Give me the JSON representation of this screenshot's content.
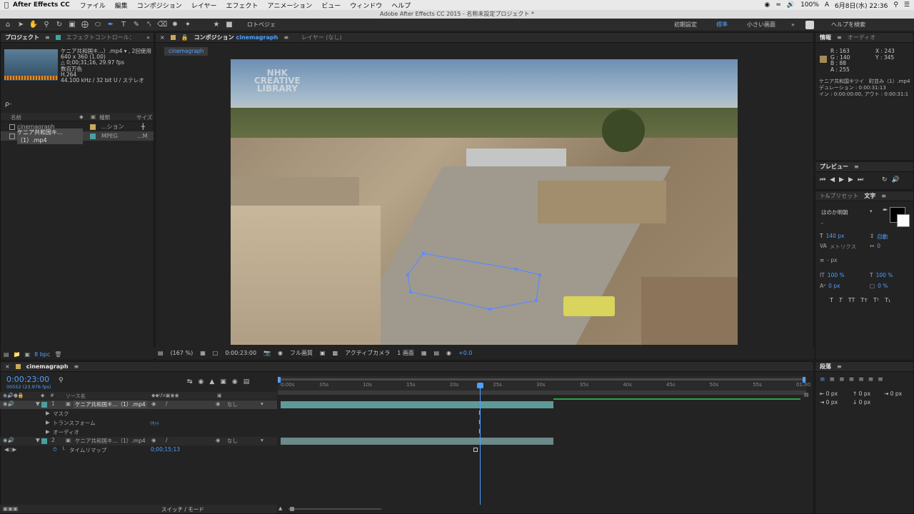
{
  "menubar": {
    "apple": "",
    "app_name": "After Effects CC",
    "items": [
      "ファイル",
      "編集",
      "コンポジション",
      "レイヤー",
      "エフェクト",
      "アニメーション",
      "ビュー",
      "ウィンドウ",
      "ヘルプ"
    ],
    "battery": "100%",
    "clock": "6月8日(水) 22:36"
  },
  "window_title": "Adobe After Effects CC 2015 - 名称未設定プロジェクト *",
  "toolbar": {
    "rotobrush": "ロトベジェ",
    "workspace_default": "初期設定",
    "workspace_standard": "標準",
    "workspace_small": "小さい画面",
    "help_search": "ヘルプを検索"
  },
  "project_panel": {
    "tab_project": "プロジェクト",
    "tab_effects": "エフェクトコントロール：",
    "asset_name": "ケニア共和国キ...）.mp4 ▾ , 2回使用",
    "asset_info": [
      "640 x 360 (1.00)",
      "△ 0;00;31;16, 29.97 fps",
      "数百万色",
      "H.264",
      "44.100 kHz / 32 bit U / ステレオ"
    ],
    "search_placeholder": "ρ-",
    "col_name": "名前",
    "col_type": "種類",
    "col_size": "サイズ",
    "items": [
      {
        "name": "cinemagraph",
        "type": "...ション",
        "size": ""
      },
      {
        "name": "ケニア共和国キ...（1）.mp4",
        "type": "MPEG",
        "size": "...M"
      }
    ],
    "bpc": "8 bpc"
  },
  "comp_panel": {
    "tab_label": "コンポジション",
    "tab_comp_name": "cinemagraph",
    "tab_layer": "レイヤー (なし)",
    "sub_tab": "cinemagraph",
    "watermark_line1": "NHK",
    "watermark_line2": "CREATIVE",
    "watermark_line3": "LIBRARY",
    "footer": {
      "zoom": "(167 %)",
      "timecode": "0:00:23:00",
      "resolution": "フル画質",
      "camera": "アクティブカメラ",
      "views": "1 画面",
      "exposure": "+0.0"
    }
  },
  "info_panel": {
    "tab_info": "情報",
    "tab_audio": "オーディオ",
    "r": "R : 163",
    "g": "G : 140",
    "b": "B : 88",
    "a": "A : 255",
    "x": "X : 243",
    "y": "Y : 345",
    "swatch_color": "#a38c58",
    "file_line": "ケニア共和国キツイ　町並み（1）.mp4",
    "duration_line": "デュレーション : 0:00:31:13",
    "inout_line": "イン : 0:00:00:00, アウト : 0:00:31:1"
  },
  "preview_panel": {
    "title": "プレビュー"
  },
  "character_panel": {
    "tab_presets": "ト&プリセット",
    "tab_character": "文字",
    "font_family": "ほのか明朝",
    "font_style": "-",
    "font_size": "140 px",
    "leading": "自動",
    "kerning": "メトリクス",
    "tracking": "0",
    "stroke": "- px",
    "vscale": "100 %",
    "hscale": "100 %",
    "baseline": "0 px",
    "tsume": "0 %"
  },
  "paragraph_panel": {
    "title": "段落",
    "indent_values": [
      "0 px",
      "0 px",
      "0 px",
      "0 px",
      "0 px"
    ]
  },
  "timeline": {
    "tab_name": "cinemagraph",
    "timecode": "0:00:23:00",
    "frame_info": "00552 (23.976 fps)",
    "col_layer_name": "ソース名",
    "col_parent": "親",
    "ruler_ticks": [
      "0:00s",
      "05s",
      "10s",
      "15s",
      "20s",
      "25s",
      "30s",
      "35s",
      "40s",
      "45s",
      "50s",
      "55s",
      "01:00"
    ],
    "layers": [
      {
        "index": "1",
        "name": "ケニア共和国キ...（1）.mp4",
        "parent": "なし"
      },
      {
        "index": "2",
        "name": "ケニア共和国キ...（1）.mp4",
        "parent": "なし"
      }
    ],
    "sub_mask": "マスク",
    "sub_transform": "トランスフォーム",
    "sub_transform_reset": "ﾘｾｯﾄ",
    "sub_audio": "オーディオ",
    "sub_timeremap": "タイムリマップ",
    "timeremap_value": "0;00;15;13",
    "switches_modes": "スイッチ / モード",
    "playhead_seconds": 23,
    "layer1_end_seconds": 31.5,
    "layer2_end_seconds": 31.5,
    "keyframe_seconds": 22.5,
    "duration_seconds": 60
  },
  "colors": {
    "accent": "#4ea0ff",
    "layer_bar_1": "#5d9a98",
    "layer_bar_2": "#6b8a89",
    "work_area": "#2fa24a"
  }
}
